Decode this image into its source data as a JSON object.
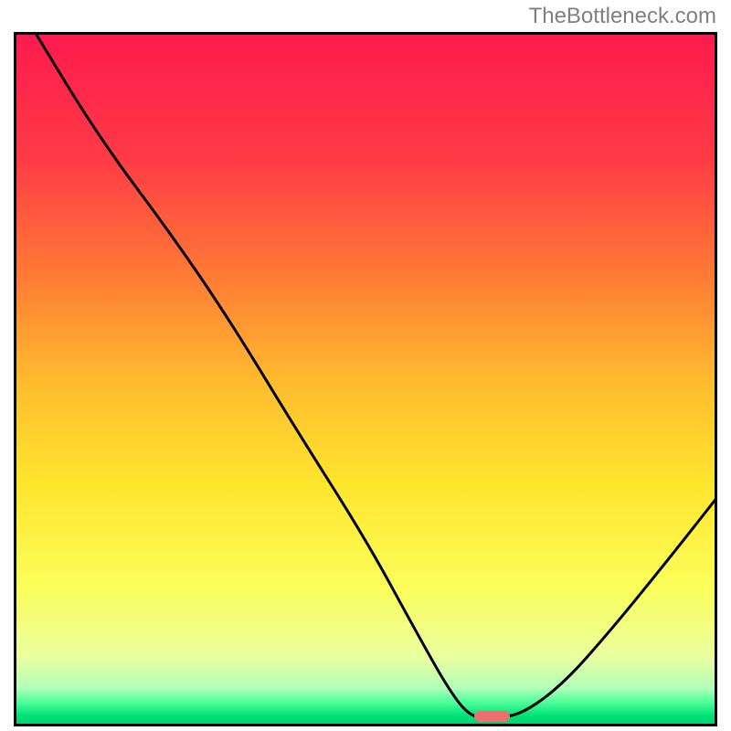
{
  "watermark": "TheBottleneck.com",
  "chart_data": {
    "type": "line",
    "title": "",
    "xlabel": "",
    "ylabel": "",
    "xlim": [
      0,
      100
    ],
    "ylim": [
      0,
      100
    ],
    "gradient_stops": [
      {
        "offset": 0.0,
        "color": "#ff1a4e"
      },
      {
        "offset": 0.18,
        "color": "#ff3a45"
      },
      {
        "offset": 0.35,
        "color": "#ff7a35"
      },
      {
        "offset": 0.5,
        "color": "#ffba2e"
      },
      {
        "offset": 0.65,
        "color": "#ffe52e"
      },
      {
        "offset": 0.8,
        "color": "#fbff5a"
      },
      {
        "offset": 0.9,
        "color": "#eaffa0"
      },
      {
        "offset": 0.945,
        "color": "#b0ffb8"
      },
      {
        "offset": 0.965,
        "color": "#4eff9a"
      },
      {
        "offset": 0.985,
        "color": "#00e074"
      },
      {
        "offset": 1.0,
        "color": "#00d06d"
      }
    ],
    "curve_points": [
      {
        "x": 3,
        "y": 100
      },
      {
        "x": 12,
        "y": 85
      },
      {
        "x": 23,
        "y": 70
      },
      {
        "x": 31,
        "y": 58
      },
      {
        "x": 40,
        "y": 43
      },
      {
        "x": 50,
        "y": 27
      },
      {
        "x": 57,
        "y": 14
      },
      {
        "x": 62,
        "y": 5
      },
      {
        "x": 65,
        "y": 1.3
      },
      {
        "x": 68,
        "y": 1.3
      },
      {
        "x": 72,
        "y": 1.6
      },
      {
        "x": 78,
        "y": 6
      },
      {
        "x": 85,
        "y": 14
      },
      {
        "x": 93,
        "y": 24
      },
      {
        "x": 100,
        "y": 33
      }
    ],
    "marker": {
      "x": 68,
      "y": 1.4,
      "width": 5,
      "height": 1.6,
      "color": "#ef6f71"
    }
  }
}
